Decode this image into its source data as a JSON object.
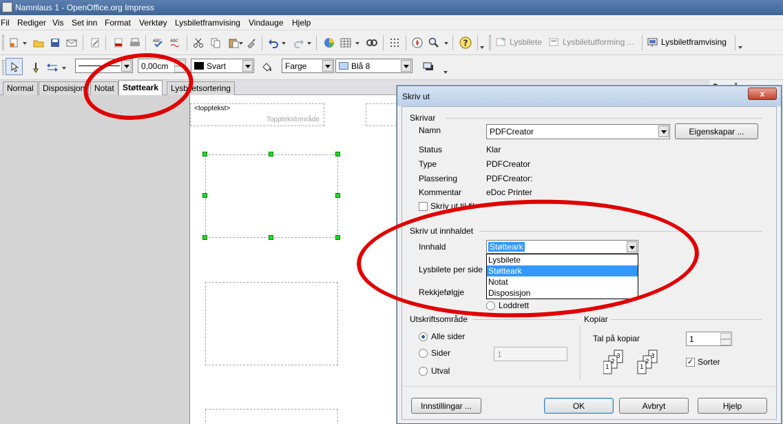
{
  "window": {
    "title": "Namnlaus 1 - OpenOffice.org Impress"
  },
  "menu": [
    "Fil",
    "Rediger",
    "Vis",
    "Set inn",
    "Format",
    "Verktøy",
    "Lysbiletframvising",
    "Vindauge",
    "Hjelp"
  ],
  "toolbar1": {
    "btn_lysbilete": "Lysbilete",
    "btn_lysbiletutforming": "Lysbiletutforming ...",
    "btn_lysbiletframvising": "Lysbiletframvising"
  },
  "toolbar2": {
    "line_width": "0,00cm",
    "line_color": "Svart",
    "area_style": "Farge",
    "area_color": "Blå 8"
  },
  "view_tabs": [
    "Normal",
    "Disposisjon",
    "Notat",
    "Støtteark",
    "Lysbiletsortering"
  ],
  "page": {
    "header_field": "<topptekst>",
    "header_area": "Topptekstområde"
  },
  "right_pane": {
    "title": "Oppgåver"
  },
  "dialog": {
    "title": "Skriv ut",
    "close": "x",
    "printer": {
      "group": "Skrivar",
      "name_label": "Namn",
      "name_value": "PDFCreator",
      "properties_button": "Eigenskapar ...",
      "status_label": "Status",
      "status_value": "Klar",
      "type_label": "Type",
      "type_value": "PDFCreator",
      "location_label": "Plassering",
      "location_value": "PDFCreator:",
      "comment_label": "Kommentar",
      "comment_value": "eDoc Printer",
      "print_to_file": "Skriv ut til fil"
    },
    "content": {
      "group": "Skriv ut innhaldet",
      "content_label": "Innhald",
      "content_value": "Støtteark",
      "options": [
        "Lysbilete",
        "Støtteark",
        "Notat",
        "Disposisjon"
      ],
      "selected_option": "Støtteark",
      "slides_per_page_label": "Lysbilete per side",
      "order_label": "Rekkjefølgje",
      "order_vertical": "Loddrett"
    },
    "range": {
      "group": "Utskriftsområde",
      "all_pages": "Alle sider",
      "pages": "Sider",
      "pages_value": "1",
      "selection": "Utval"
    },
    "copies": {
      "group": "Kopiar",
      "count_label": "Tal på kopiar",
      "count_value": "1",
      "collate": "Sorter"
    },
    "buttons": {
      "options": "Innstillingar ...",
      "ok": "OK",
      "cancel": "Avbryt",
      "help": "Hjelp"
    }
  },
  "colors": {
    "annotation": "#e00000",
    "selection": "#3399ff",
    "handle": "#29d629"
  }
}
